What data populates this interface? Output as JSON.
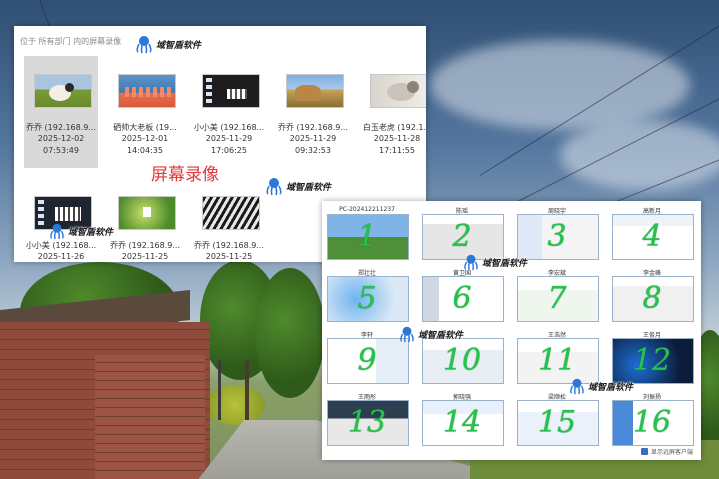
{
  "brand_watermark": "域智盾软件",
  "window1": {
    "breadcrumb": "位于 所有部门 内的屏幕录像",
    "caption": "屏幕录像",
    "tiles": [
      {
        "name": "乔乔 (192.168.9...",
        "date": "2025-12-02",
        "time": "07:53:49",
        "thumb": "sheep-photo",
        "selected": true
      },
      {
        "name": "硒帅大老板 (19...",
        "date": "2025-12-01",
        "time": "14:04:35",
        "thumb": "flamingos-photo",
        "selected": false
      },
      {
        "name": "小小美 (192.168...",
        "date": "2025-11-29",
        "time": "17:06:25",
        "thumb": "desktop-dark",
        "selected": false
      },
      {
        "name": "乔乔 (192.168.9...",
        "date": "2025-11-29",
        "time": "09:32:53",
        "thumb": "landscape-photo",
        "selected": false
      },
      {
        "name": "白玉老虎 (192.1...",
        "date": "2025-11-28",
        "time": "17:11:55",
        "thumb": "kitten-photo",
        "selected": false
      }
    ],
    "tiles_row2": [
      {
        "name": "小小美 (192.168...",
        "date": "2025-11-26",
        "thumb": "desktop-dark"
      },
      {
        "name": "乔乔 (192.168.9...",
        "date": "2025-11-25",
        "thumb": "green-desktop"
      },
      {
        "name": "乔乔 (192.168.9...",
        "date": "2025-11-25",
        "thumb": "zebra-photo"
      }
    ]
  },
  "window2": {
    "cells": [
      {
        "label": "PC-202412211237",
        "number": "1"
      },
      {
        "label": "陈瑶",
        "number": "2"
      },
      {
        "label": "周晓宇",
        "number": "3"
      },
      {
        "label": "高新月",
        "number": "4"
      },
      {
        "label": "郑壮壮",
        "number": "5"
      },
      {
        "label": "黄卫国",
        "number": "6"
      },
      {
        "label": "李宏斌",
        "number": "7"
      },
      {
        "label": "李金峰",
        "number": "8"
      },
      {
        "label": "李轩",
        "number": "9"
      },
      {
        "label": "",
        "number": "10"
      },
      {
        "label": "王浩然",
        "number": "11"
      },
      {
        "label": "王俊月",
        "number": "12"
      },
      {
        "label": "王雨彤",
        "number": "13"
      },
      {
        "label": "郭晓强",
        "number": "14"
      },
      {
        "label": "梁顺松",
        "number": "15"
      },
      {
        "label": "刘振扬",
        "number": "16"
      }
    ],
    "footer": "显示远屏客户端"
  }
}
